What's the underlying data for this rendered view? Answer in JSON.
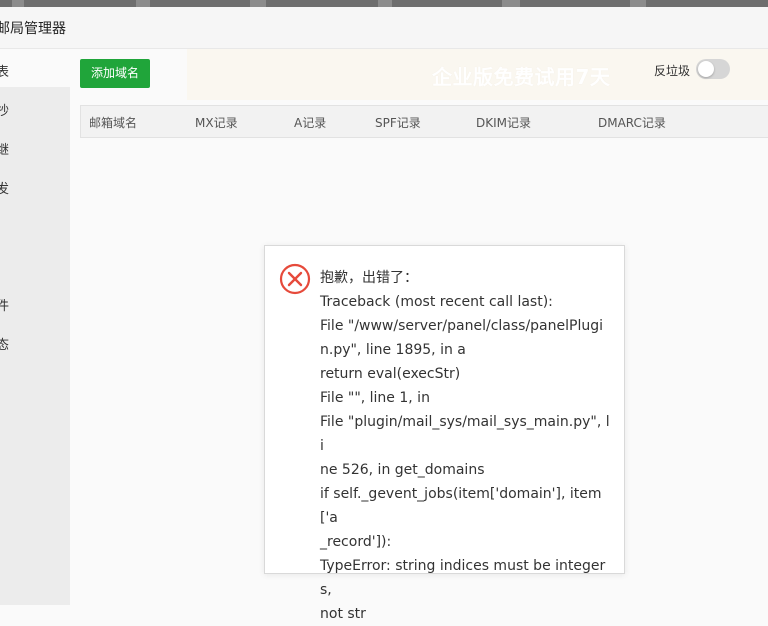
{
  "window": {
    "title": "邮局管理器"
  },
  "sidebar": {
    "items": [
      {
        "label": "表"
      },
      {
        "label": "抄"
      },
      {
        "label": "继"
      },
      {
        "label": "发"
      },
      {
        "label": "件"
      },
      {
        "label": "态"
      }
    ]
  },
  "toolbar": {
    "add_domain_label": "添加域名",
    "promo_text": "企业版免费试用7天",
    "trash_label": "反垃圾"
  },
  "table": {
    "columns": [
      "邮箱域名",
      "MX记录",
      "A记录",
      "SPF记录",
      "DKIM记录",
      "DMARC记录"
    ]
  },
  "error_dialog": {
    "lines": [
      "抱歉，出错了：",
      "Traceback (most recent call last):",
      "File \"/www/server/panel/class/panelPlugi",
      "n.py\", line 1895, in a",
      "return eval(execStr)",
      "File \"\", line 1, in",
      "File \"plugin/mail_sys/mail_sys_main.py\", li",
      "ne 526, in get_domains",
      "if self._gevent_jobs(item['domain'], item['a",
      "_record']):",
      "TypeError: string indices must be integers,",
      "not str"
    ]
  },
  "colors": {
    "primary": "#20a53a",
    "error": "#e64a3b"
  },
  "icons": {
    "error": "error-circle-x-icon",
    "toggle": "toggle-switch"
  }
}
